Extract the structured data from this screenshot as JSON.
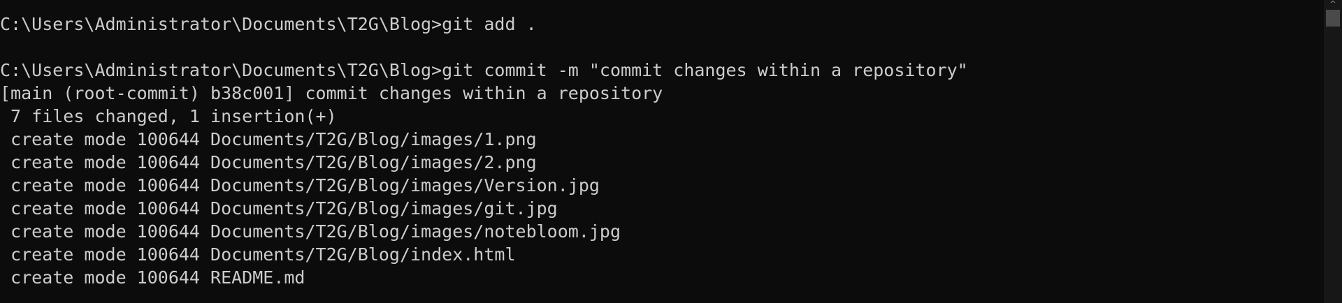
{
  "terminal": {
    "lines": [
      "C:\\Users\\Administrator\\Documents\\T2G\\Blog>git add .",
      "",
      "C:\\Users\\Administrator\\Documents\\T2G\\Blog>git commit -m \"commit changes within a repository\"",
      "[main (root-commit) b38c001] commit changes within a repository",
      " 7 files changed, 1 insertion(+)",
      " create mode 100644 Documents/T2G/Blog/images/1.png",
      " create mode 100644 Documents/T2G/Blog/images/2.png",
      " create mode 100644 Documents/T2G/Blog/images/Version.jpg",
      " create mode 100644 Documents/T2G/Blog/images/git.jpg",
      " create mode 100644 Documents/T2G/Blog/images/notebloom.jpg",
      " create mode 100644 Documents/T2G/Blog/index.html",
      " create mode 100644 README.md"
    ]
  },
  "scrollbar": {
    "up_arrow_glyph": "^",
    "up_arrow_icon": "chevron-up-icon"
  },
  "colors": {
    "background": "#0c0c0c",
    "foreground": "#cccccc",
    "scrollbar_track": "#171717",
    "scrollbar_thumb": "#4a4a4a"
  }
}
